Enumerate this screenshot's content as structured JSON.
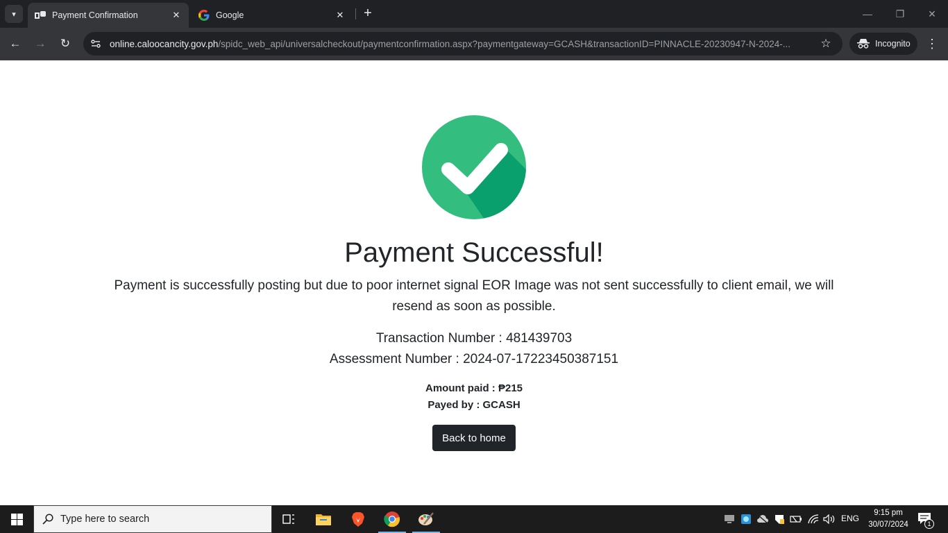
{
  "browser": {
    "tabs": [
      {
        "title": "Payment Confirmation",
        "active": true,
        "favicon": "site-icon"
      },
      {
        "title": "Google",
        "active": false,
        "favicon": "google-g-icon"
      }
    ],
    "url_host": "online.caloocancity.gov.ph",
    "url_path": "/spidc_web_api/universalcheckout/paymentconfirmation.aspx?paymentgateway=GCASH&transactionID=PINNACLE-20230947-N-2024-...",
    "incognito_label": "Incognito"
  },
  "page": {
    "heading": "Payment Successful!",
    "message": "Payment is successfully posting but due to poor internet signal EOR Image was not sent successfully to client email, we will resend as soon as possible.",
    "transaction_line": "Transaction Number : 481439703",
    "assessment_line": "Assessment Number : 2024-07-17223450387151",
    "amount_line": "Amount paid : ₱215",
    "payed_line": "Payed by : GCASH",
    "back_button": "Back to home",
    "colors": {
      "check_circle": "#33bd7e",
      "check_shadow": "#0aa06e",
      "button": "#212529"
    }
  },
  "taskbar": {
    "search_placeholder": "Type here to search",
    "language": "ENG",
    "time": "9:15 pm",
    "date": "30/07/2024",
    "notification_count": "1"
  }
}
